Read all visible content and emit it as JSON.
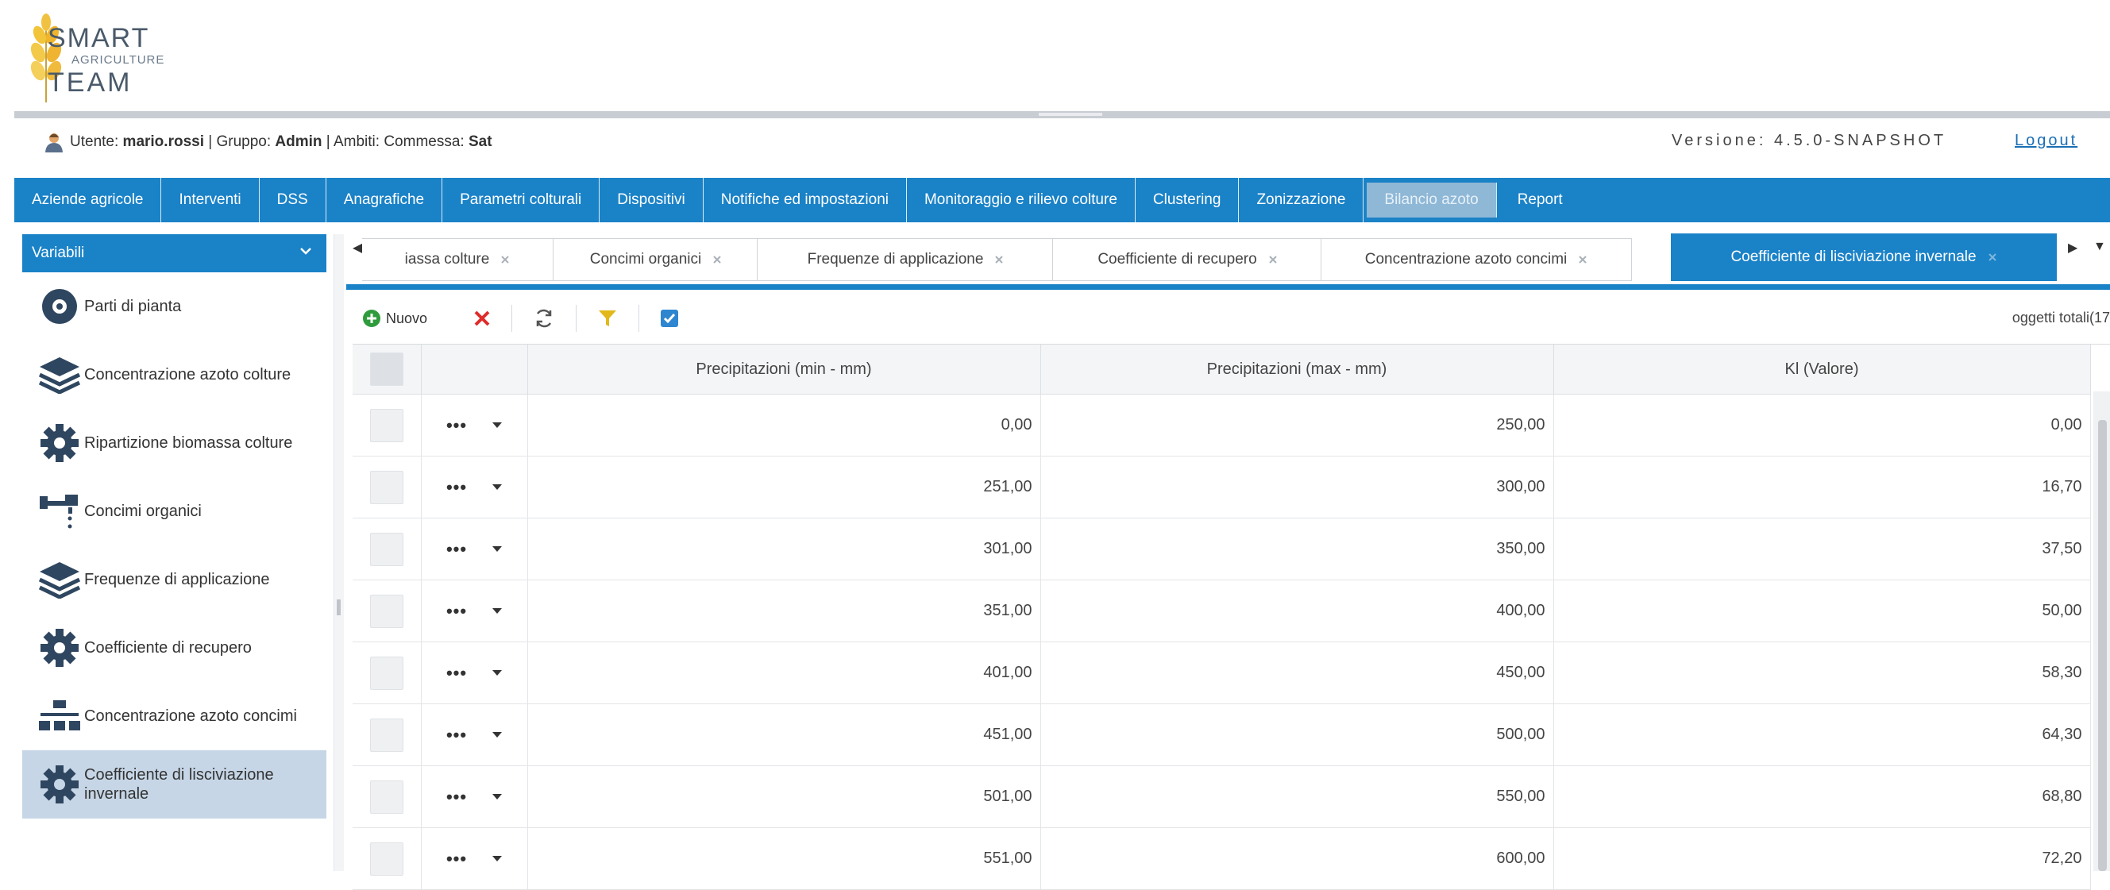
{
  "logo": {
    "line1": "SMART",
    "line2": "AGRICULTURE",
    "line3": "TEAM"
  },
  "user": {
    "label_user": "Utente:",
    "username": "mario.rossi",
    "label_group": "Gruppo:",
    "group": "Admin",
    "label_scope": "Ambiti: Commessa:",
    "scope": "Sat"
  },
  "version": "Versione: 4.5.0-SNAPSHOT",
  "logout": "Logout",
  "nav": [
    "Aziende agricole",
    "Interventi",
    "DSS",
    "Anagrafiche",
    "Parametri colturali",
    "Dispositivi",
    "Notifiche ed impostazioni",
    "Monitoraggio e rilievo colture",
    "Clustering",
    "Zonizzazione",
    "Bilancio azoto",
    "Report"
  ],
  "nav_active": "Bilancio azoto",
  "sidebar": {
    "title": "Variabili",
    "items": [
      {
        "label": "Parti di pianta",
        "icon": "gear-badge-icon"
      },
      {
        "label": "Concentrazione azoto colture",
        "icon": "layers-icon"
      },
      {
        "label": "Ripartizione biomassa colture",
        "icon": "gear-icon"
      },
      {
        "label": "Concimi organici",
        "icon": "fertilizer-icon"
      },
      {
        "label": "Frequenze di applicazione",
        "icon": "layers-icon"
      },
      {
        "label": "Coefficiente di recupero",
        "icon": "gear-icon"
      },
      {
        "label": "Concentrazione azoto concimi",
        "icon": "hierarchy-icon"
      },
      {
        "label": "Coefficiente di lisciviazione invernale",
        "icon": "gear-icon"
      }
    ],
    "selected": "Coefficiente di lisciviazione invernale"
  },
  "tabs": [
    {
      "label": "iassa colture"
    },
    {
      "label": "Concimi organici"
    },
    {
      "label": "Frequenze di applicazione"
    },
    {
      "label": "Coefficiente di recupero"
    },
    {
      "label": "Concentrazione azoto concimi"
    },
    {
      "label": "Coefficiente di lisciviazione invernale"
    }
  ],
  "active_tab": "Coefficiente di lisciviazione invernale",
  "toolbar": {
    "new_label": "Nuovo",
    "count_label": "oggetti totali(17"
  },
  "grid": {
    "columns": [
      "Precipitazioni (min - mm)",
      "Precipitazioni (max - mm)",
      "Kl (Valore)"
    ],
    "rows": [
      [
        "0,00",
        "250,00",
        "0,00"
      ],
      [
        "251,00",
        "300,00",
        "16,70"
      ],
      [
        "301,00",
        "350,00",
        "37,50"
      ],
      [
        "351,00",
        "400,00",
        "50,00"
      ],
      [
        "401,00",
        "450,00",
        "58,30"
      ],
      [
        "451,00",
        "500,00",
        "64,30"
      ],
      [
        "501,00",
        "550,00",
        "68,80"
      ],
      [
        "551,00",
        "600,00",
        "72,20"
      ]
    ]
  },
  "colors": {
    "primary": "#1a82c7",
    "selected": "#c6d6e6",
    "accent": "#e6a21a"
  }
}
